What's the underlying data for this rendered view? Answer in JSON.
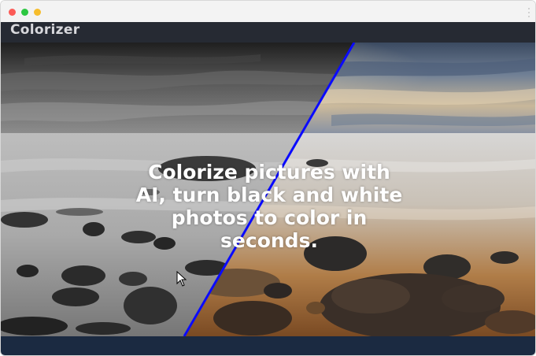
{
  "window": {
    "controls": [
      "close",
      "minimize",
      "maximize"
    ],
    "menu_icon": "kebab-menu-icon"
  },
  "app": {
    "title": "Colorizer"
  },
  "hero": {
    "headline": "Colorize pictures with AI, turn black and white photos to color in seconds.",
    "image_description_left": "black-and-white",
    "image_description_right": "color",
    "divider_color": "#0a0aff"
  },
  "colors": {
    "header_bg": "#262a33",
    "footer_bg": "#1b2a41",
    "title_text": "#d8d8dc"
  }
}
